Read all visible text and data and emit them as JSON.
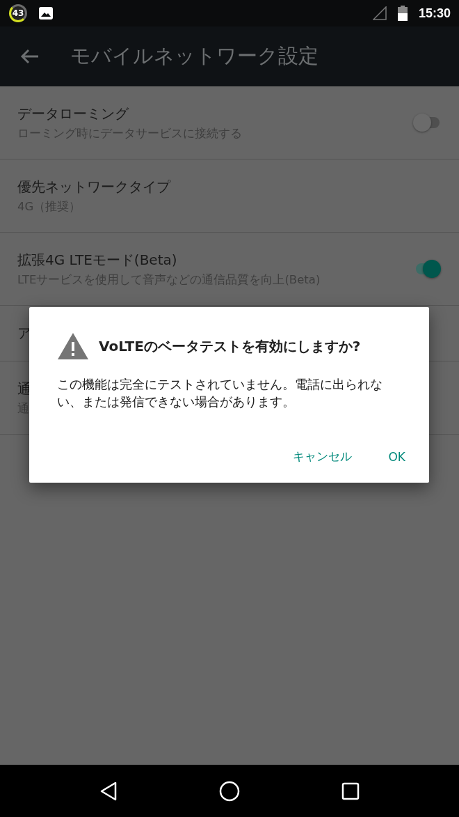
{
  "status_bar": {
    "badge": "43",
    "time": "15:30"
  },
  "app_bar": {
    "title": "モバイルネットワーク設定"
  },
  "settings": [
    {
      "kind": "switch",
      "title": "データローミング",
      "summary": "ローミング時にデータサービスに接続する",
      "on": false
    },
    {
      "kind": "text",
      "title": "優先ネットワークタイプ",
      "summary": "4G（推奨）"
    },
    {
      "kind": "switch",
      "title": "拡張4G LTEモード(Beta)",
      "summary": "LTEサービスを使用して音声などの通信品質を向上(Beta)",
      "on": true
    },
    {
      "kind": "text",
      "title": "ア"
    },
    {
      "kind": "text",
      "title": "通",
      "summary": "通"
    }
  ],
  "dialog": {
    "title": "VoLTEのベータテストを有効にしますか?",
    "message": "この機能は完全にテストされていません。電話に出られない、または発信できない場合があります。",
    "buttons": [
      "キャンセル",
      "OK"
    ]
  }
}
